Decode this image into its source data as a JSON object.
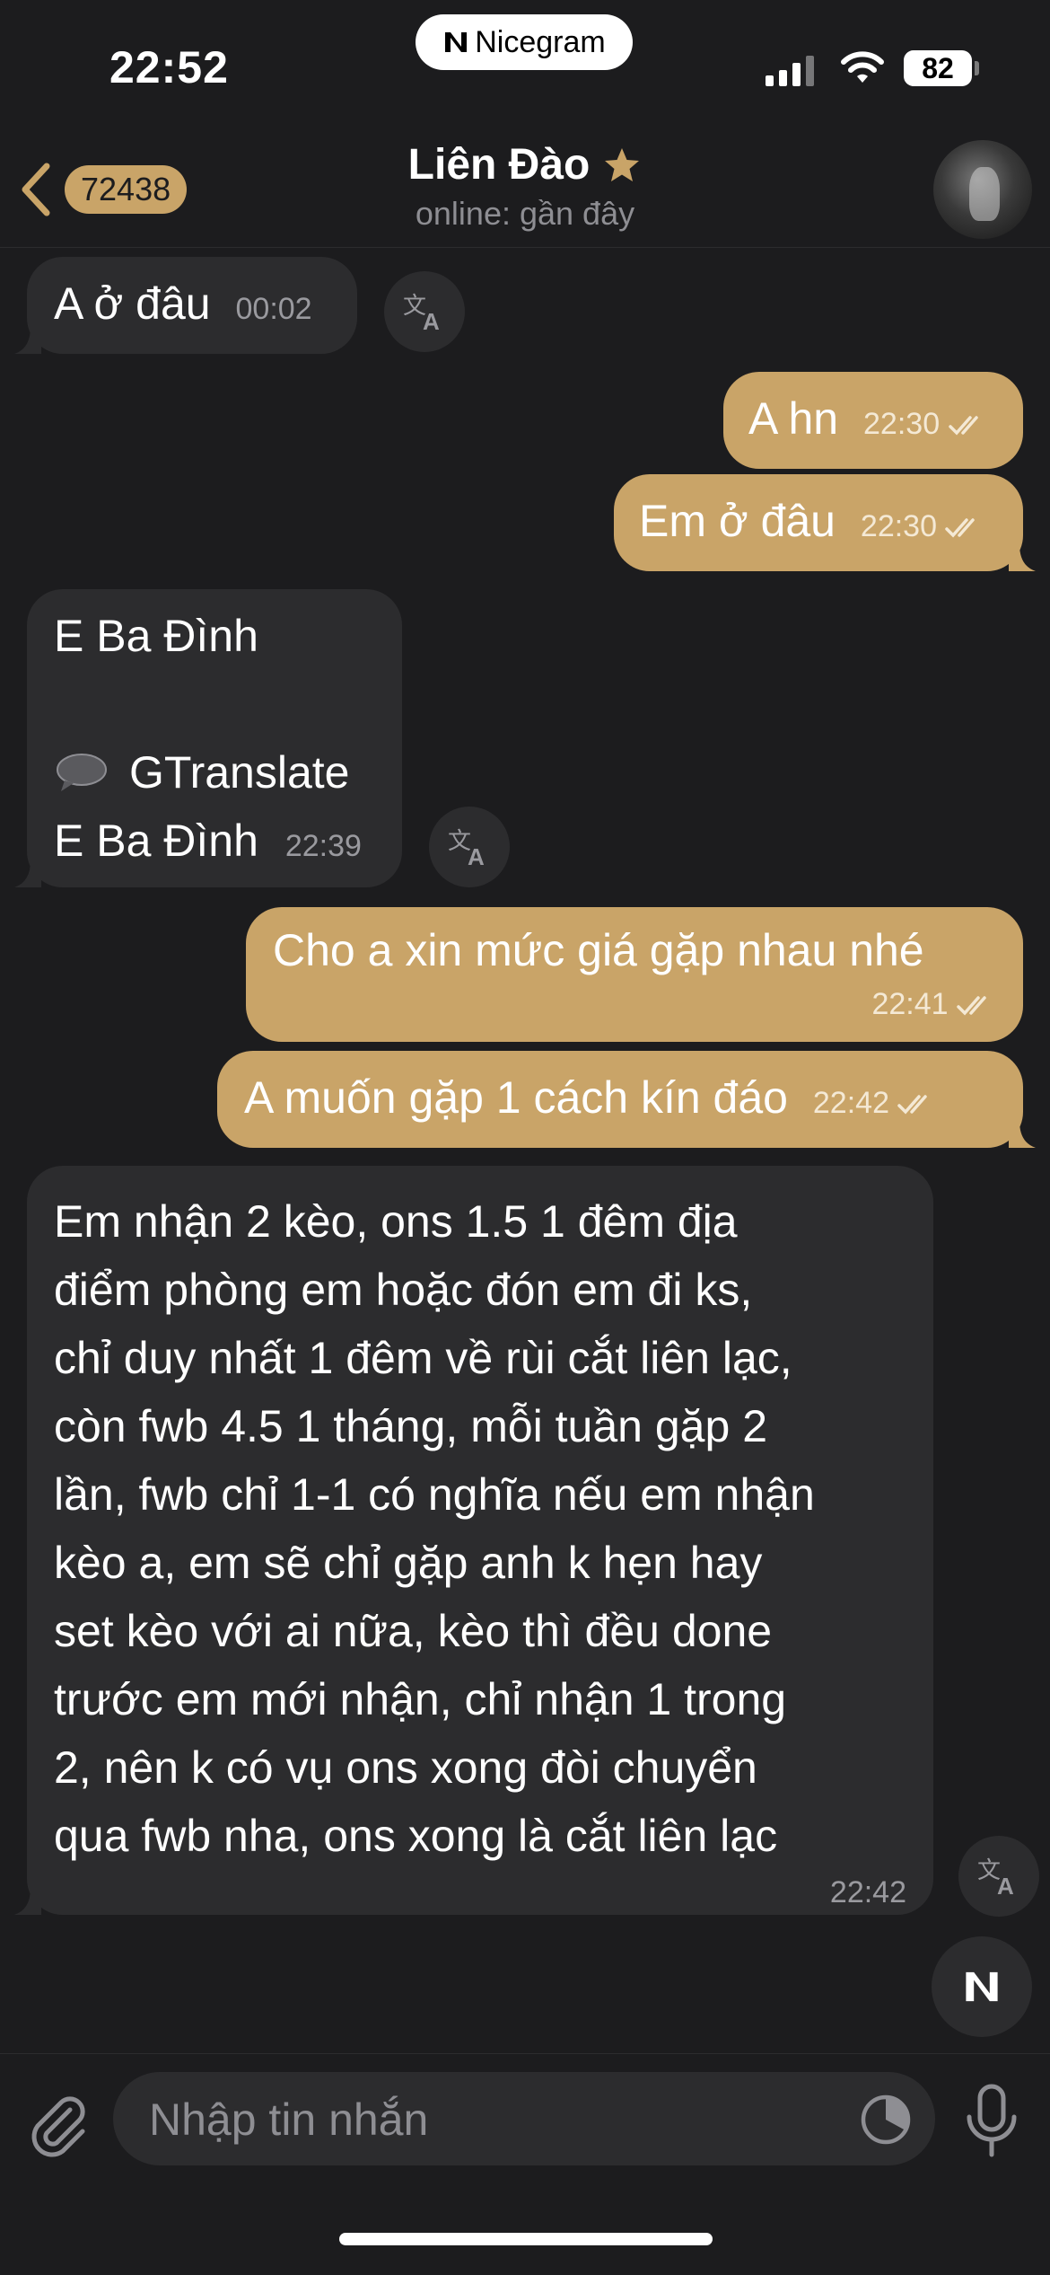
{
  "status_bar": {
    "time": "22:52",
    "app_badge": "Nicegram",
    "battery": "82"
  },
  "header": {
    "back_count": "72438",
    "name": "Liên Đào",
    "status": "online: gần đây"
  },
  "messages": [
    {
      "direction": "in",
      "text": "A ở đâu",
      "time": "00:02"
    },
    {
      "direction": "out",
      "text": "A hn",
      "time": "22:30",
      "read": true
    },
    {
      "direction": "out",
      "text": "Em ở đâu",
      "time": "22:30",
      "read": true
    },
    {
      "direction": "in",
      "text": "E Ba Đình",
      "translate_label": "GTranslate",
      "translated": "E Ba Đình",
      "time": "22:39"
    },
    {
      "direction": "out",
      "text": "Cho a xin mức giá gặp nhau nhé",
      "time": "22:41",
      "read": true
    },
    {
      "direction": "out",
      "text": "A muốn gặp 1 cách kín đáo",
      "time": "22:42",
      "read": true
    },
    {
      "direction": "in",
      "lines": [
        "Em nhận 2 kèo, ons 1.5 1 đêm địa",
        "điểm phòng em hoặc đón em đi ks,",
        "chỉ duy nhất 1 đêm về rùi cắt liên lạc,",
        "còn fwb 4.5 1 tháng, mỗi tuần gặp 2",
        "lần, fwb chỉ 1-1 có nghĩa nếu em nhận",
        "kèo a, em sẽ chỉ gặp anh k hẹn hay",
        "set kèo với ai nữa, kèo thì đều done",
        "trước em mới nhận, chỉ nhận 1 trong",
        "2, nên k có vụ ons xong đòi chuyển",
        "qua fwb nha, ons xong là cắt liên lạc"
      ],
      "time": "22:42"
    }
  ],
  "input": {
    "placeholder": "Nhập tin nhắn"
  },
  "colors": {
    "background": "#1c1c1e",
    "incoming_bubble": "#2c2c2e",
    "outgoing_bubble": "#c9a468",
    "accent": "#c9a468"
  }
}
